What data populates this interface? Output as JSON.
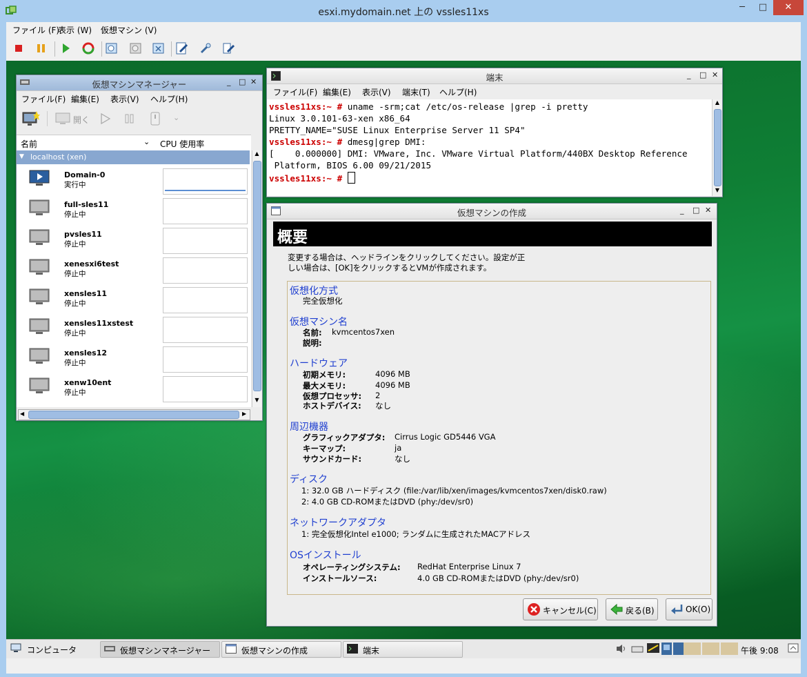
{
  "outer": {
    "title": "esxi.mydomain.net 上の vssles11xs",
    "menu": [
      "ファイル (F)",
      "表示 (W)",
      "仮想マシン (V)"
    ],
    "min": "─",
    "max": "□",
    "close": "✕"
  },
  "vmm": {
    "title": "仮想マシンマネージャー",
    "menu": [
      "ファイル(F)",
      "編集(E)",
      "表示(V)",
      "ヘルプ(H)"
    ],
    "open_label": "開く",
    "col_name": "名前",
    "col_cpu": "CPU 使用率",
    "group": "localhost (xen)",
    "vms": [
      {
        "name": "Domain-0",
        "state": "実行中",
        "running": true
      },
      {
        "name": "full-sles11",
        "state": "停止中",
        "running": false
      },
      {
        "name": "pvsles11",
        "state": "停止中",
        "running": false
      },
      {
        "name": "xenesxi6test",
        "state": "停止中",
        "running": false
      },
      {
        "name": "xensles11",
        "state": "停止中",
        "running": false
      },
      {
        "name": "xensles11xstest",
        "state": "停止中",
        "running": false
      },
      {
        "name": "xensles12",
        "state": "停止中",
        "running": false
      },
      {
        "name": "xenw10ent",
        "state": "停止中",
        "running": false
      }
    ]
  },
  "terminal": {
    "title": "端末",
    "menu": [
      "ファイル(F)",
      "編集(E)",
      "表示(V)",
      "端末(T)",
      "ヘルプ(H)"
    ],
    "prompt": "vssles11xs:~ #",
    "cmd1": " uname -srm;cat /etc/os-release |grep -i pretty",
    "out1": "Linux 3.0.101-63-xen x86_64",
    "out2": "PRETTY_NAME=\"SUSE Linux Enterprise Server 11 SP4\"",
    "cmd2": " dmesg|grep DMI:",
    "out3": "[    0.000000] DMI: VMware, Inc. VMware Virtual Platform/440BX Desktop Reference",
    "out4": " Platform, BIOS 6.00 09/21/2015"
  },
  "create": {
    "title": "仮想マシンの作成",
    "header": "概要",
    "intro1": "変更する場合は、ヘッドラインをクリックしてください。設定が正",
    "intro2": "しい場合は、[OK]をクリックするとVMが作成されます。",
    "virt_head": "仮想化方式",
    "virt_val": "完全仮想化",
    "name_head": "仮想マシン名",
    "name_k": "名前:",
    "name_v": "kvmcentos7xen",
    "desc_k": "説明:",
    "hw_head": "ハードウェア",
    "mem_init_k": "初期メモリ:",
    "mem_init_v": "4096 MB",
    "mem_max_k": "最大メモリ:",
    "mem_max_v": "4096 MB",
    "cpu_k": "仮想プロセッサ:",
    "cpu_v": "2",
    "hostdev_k": "ホストデバイス:",
    "hostdev_v": "なし",
    "periph_head": "周辺機器",
    "gfx_k": "グラフィックアダプタ:",
    "gfx_v": "Cirrus Logic GD5446 VGA",
    "kbd_k": "キーマップ:",
    "kbd_v": "ja",
    "snd_k": "サウンドカード:",
    "snd_v": "なし",
    "disk_head": "ディスク",
    "disk1": "1: 32.0 GB ハードディスク (file:/var/lib/xen/images/kvmcentos7xen/disk0.raw)",
    "disk2": "2: 4.0 GB CD-ROMまたはDVD (phy:/dev/sr0)",
    "net_head": "ネットワークアダプタ",
    "net1": "1: 完全仮想化Intel e1000; ランダムに生成されたMACアドレス",
    "os_head": "OSインストール",
    "os_k": "オペレーティングシステム:",
    "os_v": "RedHat Enterprise Linux 7",
    "src_k": "インストールソース:",
    "src_v": "4.0 GB CD-ROMまたはDVD (phy:/dev/sr0)",
    "cancel": "キャンセル(C)",
    "back": "戻る(B)",
    "ok": "OK(O)"
  },
  "taskbar": {
    "computer": "コンピュータ",
    "vmm": "仮想マシンマネージャー",
    "create": "仮想マシンの作成",
    "term": "端末",
    "clock": "午後 9:08"
  },
  "colors": {
    "prompt": "#cc0000",
    "section_link": "#1f3fd0",
    "desktop_green": "#0f7f35",
    "selection": "#88a7d0"
  }
}
